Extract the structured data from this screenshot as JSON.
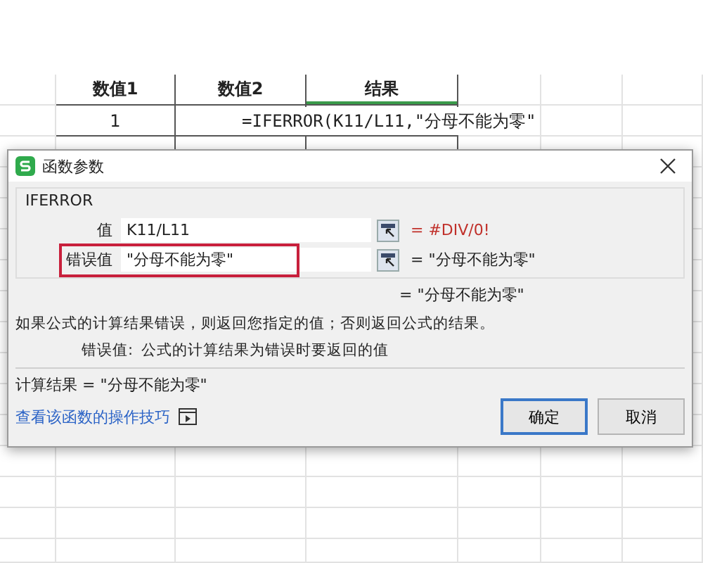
{
  "sheet": {
    "headers": [
      "数值1",
      "数值2",
      "结果"
    ],
    "rows": [
      [
        "1"
      ]
    ],
    "editing_formula": "=IFERROR(K11/L11,\"分母不能为零\""
  },
  "dialog": {
    "title": "函数参数",
    "function_name": "IFERROR",
    "params": [
      {
        "label": "值",
        "value": "K11/L11",
        "result": "= #DIV/0!",
        "error": true,
        "highlighted": false
      },
      {
        "label": "错误值",
        "value": "\"分母不能为零\"",
        "result": "= \"分母不能为零\"",
        "error": false,
        "highlighted": true
      }
    ],
    "formula_result": "= \"分母不能为零\"",
    "description": "如果公式的计算结果错误，则返回您指定的值；否则返回公式的结果。",
    "param_help_label": "错误值:",
    "param_help_text": "公式的计算结果为错误时要返回的值",
    "calc_result": "计算结果 = \"分母不能为零\"",
    "help_link": "查看该函数的操作技巧",
    "buttons": [
      {
        "label": "确定",
        "default": true
      },
      {
        "label": "取消",
        "default": false
      }
    ]
  }
}
